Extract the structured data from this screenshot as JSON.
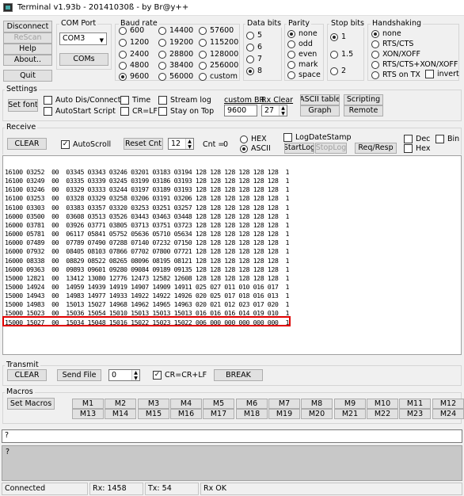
{
  "window": {
    "title": "Terminal v1.93b - 20141030ß - by Br@y++"
  },
  "left_buttons": {
    "disconnect": "Disconnect",
    "rescan": "ReScan",
    "help": "Help",
    "about": "About..",
    "quit": "Quit"
  },
  "com_port": {
    "label": "COM Port",
    "value": "COM3",
    "coms_button": "COMs"
  },
  "baud": {
    "label": "Baud rate",
    "options": [
      "600",
      "1200",
      "2400",
      "4800",
      "9600",
      "14400",
      "19200",
      "28800",
      "38400",
      "56000",
      "57600",
      "115200",
      "128000",
      "256000",
      "custom"
    ],
    "selected": "9600"
  },
  "data_bits": {
    "label": "Data bits",
    "options": [
      "5",
      "6",
      "7",
      "8"
    ],
    "selected": "8"
  },
  "parity": {
    "label": "Parity",
    "options": [
      "none",
      "odd",
      "even",
      "mark",
      "space"
    ],
    "selected": "none"
  },
  "stop_bits": {
    "label": "Stop bits",
    "options": [
      "1",
      "1.5",
      "2"
    ],
    "selected": "1"
  },
  "handshaking": {
    "label": "Handshaking",
    "options": [
      "none",
      "RTS/CTS",
      "XON/XOFF",
      "RTS/CTS+XON/XOFF",
      "RTS on TX"
    ],
    "selected": "none",
    "invert_label": "invert"
  },
  "settings": {
    "label": "Settings",
    "set_font": "Set font",
    "auto_dis_connect": "Auto Dis/Connect",
    "autostart_script": "AutoStart Script",
    "time": "Time",
    "cr_lf": "CR=LF",
    "stream_log": "Stream log",
    "stay_on_top": "Stay on Top",
    "custom_br_label": "custom BR",
    "custom_br_value": "9600",
    "rx_clear_label": "Rx Clear",
    "rx_clear_value": "27",
    "ascii_table": "ASCII table",
    "graph": "Graph",
    "scripting": "Scripting",
    "remote": "Remote"
  },
  "receive": {
    "label": "Receive",
    "clear": "CLEAR",
    "autoscroll": "AutoScroll",
    "reset_cnt": "Reset Cnt",
    "cnt_spin": "12",
    "cnt_label": "Cnt =",
    "cnt_value": "0",
    "hex": "HEX",
    "ascii": "ASCII",
    "log_date_stamp": "LogDateStamp",
    "start_log": "StartLog",
    "stop_log": "StopLog",
    "req_resp": "Req/Resp",
    "dec": "Dec",
    "bin": "Bin",
    "hex_chk": "Hex",
    "lines": [
      "16100 03252  00  03345 03343 03246 03201 03183 03194 128 128 128 128 128 128  1",
      "16100 03249  00  03335 03339 03245 03199 03186 03193 128 128 128 128 128 128  1",
      "16100 03246  00  03329 03333 03244 03197 03189 03193 128 128 128 128 128 128  1",
      "16100 03253  00  03328 03329 03258 03206 03191 03206 128 128 128 128 128 128  1",
      "16100 03303  00  03383 03357 03320 03253 03251 03257 128 128 128 128 128 128  1",
      "16000 03500  00  03608 03513 03526 03443 03463 03448 128 128 128 128 128 128  1",
      "16000 03781  00  03926 03771 03805 03713 03751 03723 128 128 128 128 128 128  1",
      "16000 05781  00  06117 05841 05752 05636 05710 05634 128 128 128 128 128 128  1",
      "16000 07489  00  07789 07490 07288 07140 07232 07150 128 128 128 128 128 128  1",
      "16000 07932  00  08405 08103 07866 07702 07800 07721 128 128 128 128 128 128  1",
      "16000 08338  00  08829 08522 08265 08096 08195 08121 128 128 128 128 128 128  1",
      "16000 09363  00  09893 09601 09280 09084 09189 09135 128 128 128 128 128 128  1",
      "15000 12821  00  13412 13080 12776 12473 12582 12608 128 128 128 128 128 128  1",
      "15000 14924  00  14959 14939 14919 14907 14909 14911 025 027 011 010 016 017  1",
      "15000 14943  00  14983 14977 14933 14922 14922 14926 020 025 017 018 016 013  1",
      "15000 14983  00  15013 15027 14968 14962 14965 14963 020 021 012 023 017 020  1",
      "15000 15023  00  15036 15054 15010 15013 15013 15013 016 016 016 014 019 010  1",
      "15000 15027  00  15034 15048 15016 15022 15023 15022 006 000 000 000 000 000  1"
    ]
  },
  "transmit": {
    "label": "Transmit",
    "clear": "CLEAR",
    "send_file": "Send File",
    "spin_value": "0",
    "cr_crlf": "CR=CR+LF",
    "break": "BREAK"
  },
  "macros": {
    "label": "Macros",
    "set_macros": "Set Macros",
    "row1": [
      "M1",
      "M2",
      "M3",
      "M4",
      "M5",
      "M6",
      "M7",
      "M8",
      "M9",
      "M10",
      "M11",
      "M12"
    ],
    "row2": [
      "M13",
      "M14",
      "M15",
      "M16",
      "M17",
      "M18",
      "M19",
      "M20",
      "M21",
      "M22",
      "M23",
      "M24"
    ]
  },
  "send_input": {
    "value": "?"
  },
  "history_text": "?",
  "status": {
    "connected": "Connected",
    "rx": "Rx: 1458",
    "tx": "Tx: 54",
    "rx_ok": "Rx OK"
  }
}
